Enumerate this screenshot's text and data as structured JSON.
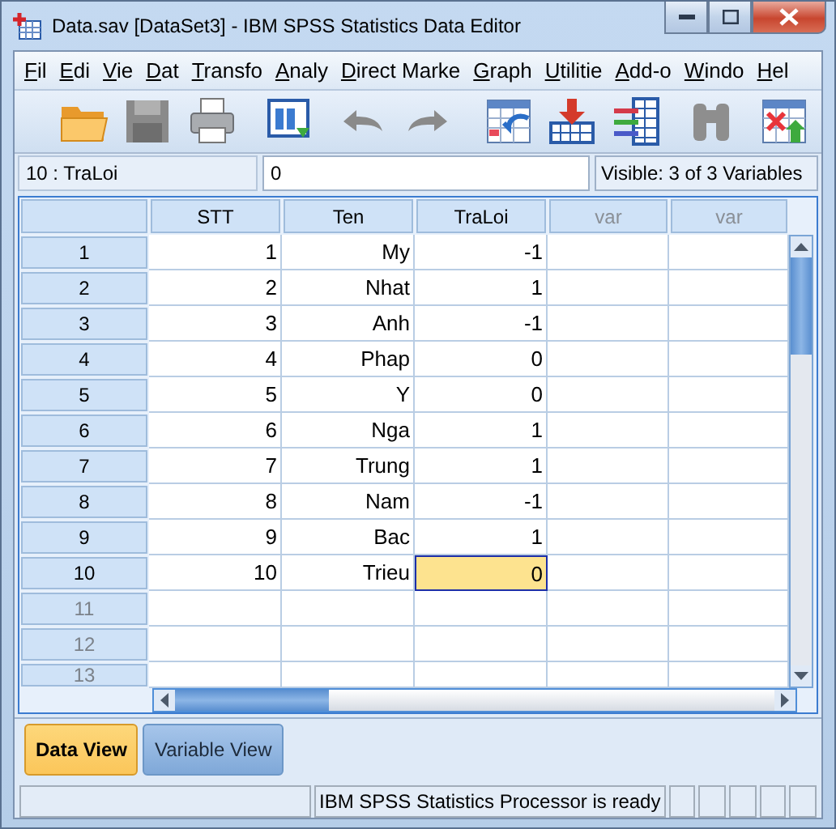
{
  "window": {
    "title": "Data.sav [DataSet3] - IBM SPSS Statistics Data Editor"
  },
  "menu": [
    "Fil",
    "Edi",
    "Vie",
    "Dat",
    "Transfo",
    "Analy",
    "Direct Marke",
    "Graph",
    "Utilitie",
    "Add-o",
    "Windo",
    "Hel"
  ],
  "toolbar": [
    {
      "kind": "open",
      "disabled": false
    },
    {
      "kind": "save",
      "disabled": true
    },
    {
      "kind": "print",
      "disabled": false
    },
    {
      "kind": "recall",
      "disabled": false
    },
    {
      "kind": "undo",
      "disabled": true
    },
    {
      "kind": "redo",
      "disabled": true
    },
    {
      "kind": "goto",
      "disabled": false
    },
    {
      "kind": "import",
      "disabled": false
    },
    {
      "kind": "variables",
      "disabled": false
    },
    {
      "kind": "find",
      "disabled": true
    },
    {
      "kind": "insert",
      "disabled": false
    }
  ],
  "cell_bar": {
    "reference": "10 : TraLoi",
    "value": "0",
    "visible": "Visible: 3 of 3 Variables"
  },
  "table": {
    "columns": [
      {
        "label": "STT",
        "kind": "variable"
      },
      {
        "label": "Ten",
        "kind": "variable"
      },
      {
        "label": "TraLoi",
        "kind": "variable"
      },
      {
        "label": "var",
        "kind": "empty"
      },
      {
        "label": "var",
        "kind": "empty"
      }
    ],
    "rows": [
      {
        "number": "1",
        "dimmed": false,
        "cells": [
          {
            "value": "1",
            "selected": false
          },
          {
            "value": "My",
            "selected": false
          },
          {
            "value": "-1",
            "selected": false
          }
        ]
      },
      {
        "number": "2",
        "dimmed": false,
        "cells": [
          {
            "value": "2",
            "selected": false
          },
          {
            "value": "Nhat",
            "selected": false
          },
          {
            "value": "1",
            "selected": false
          }
        ]
      },
      {
        "number": "3",
        "dimmed": false,
        "cells": [
          {
            "value": "3",
            "selected": false
          },
          {
            "value": "Anh",
            "selected": false
          },
          {
            "value": "-1",
            "selected": false
          }
        ]
      },
      {
        "number": "4",
        "dimmed": false,
        "cells": [
          {
            "value": "4",
            "selected": false
          },
          {
            "value": "Phap",
            "selected": false
          },
          {
            "value": "0",
            "selected": false
          }
        ]
      },
      {
        "number": "5",
        "dimmed": false,
        "cells": [
          {
            "value": "5",
            "selected": false
          },
          {
            "value": "Y",
            "selected": false
          },
          {
            "value": "0",
            "selected": false
          }
        ]
      },
      {
        "number": "6",
        "dimmed": false,
        "cells": [
          {
            "value": "6",
            "selected": false
          },
          {
            "value": "Nga",
            "selected": false
          },
          {
            "value": "1",
            "selected": false
          }
        ]
      },
      {
        "number": "7",
        "dimmed": false,
        "cells": [
          {
            "value": "7",
            "selected": false
          },
          {
            "value": "Trung",
            "selected": false
          },
          {
            "value": "1",
            "selected": false
          }
        ]
      },
      {
        "number": "8",
        "dimmed": false,
        "cells": [
          {
            "value": "8",
            "selected": false
          },
          {
            "value": "Nam",
            "selected": false
          },
          {
            "value": "-1",
            "selected": false
          }
        ]
      },
      {
        "number": "9",
        "dimmed": false,
        "cells": [
          {
            "value": "9",
            "selected": false
          },
          {
            "value": "Bac",
            "selected": false
          },
          {
            "value": "1",
            "selected": false
          }
        ]
      },
      {
        "number": "10",
        "dimmed": false,
        "cells": [
          {
            "value": "10",
            "selected": false
          },
          {
            "value": "Trieu",
            "selected": false
          },
          {
            "value": "0",
            "selected": true
          }
        ]
      },
      {
        "number": "11",
        "dimmed": true
      },
      {
        "number": "12",
        "dimmed": true
      },
      {
        "number": "13",
        "dimmed": true
      }
    ]
  },
  "tabs": [
    {
      "label": "Data View",
      "selected": true
    },
    {
      "label": "Variable View",
      "selected": false
    }
  ],
  "status_bar": {
    "message": "IBM SPSS Statistics Processor is ready"
  }
}
